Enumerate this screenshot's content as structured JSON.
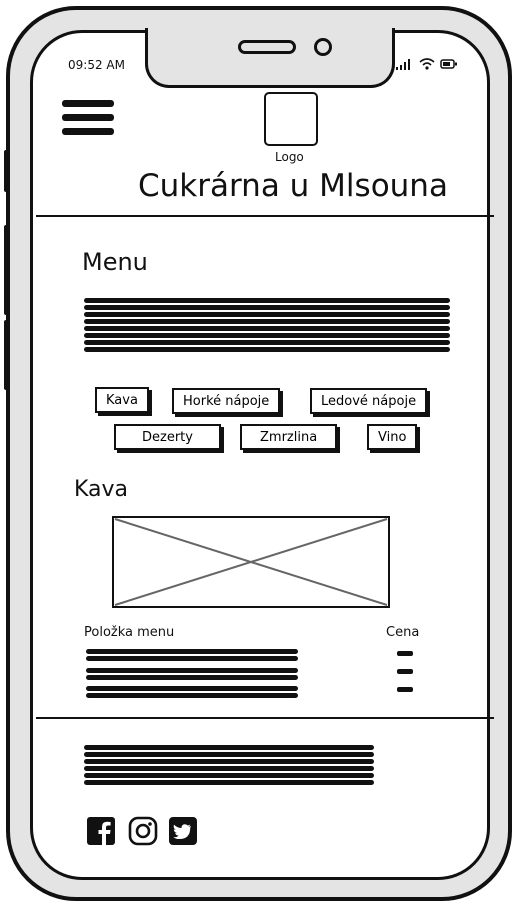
{
  "status_bar": {
    "time": "09:52 AM",
    "icons": ".ıl ⌔ ▭"
  },
  "header": {
    "logo_label": "Logo",
    "title": "Cukrárna u Mlsouna"
  },
  "menu_section": {
    "title": "Menu",
    "categories": [
      "Kava",
      "Horké nápoje",
      "Ledové nápoje",
      "Dezerty",
      "Zmrzlina",
      "Vino"
    ]
  },
  "kava_section": {
    "title": "Kava",
    "column_item": "Položka menu",
    "column_price": "Cena"
  },
  "icons": {
    "hamburger": "hamburger-menu-icon",
    "facebook": "facebook-icon",
    "instagram": "instagram-icon",
    "twitter": "twitter-icon"
  }
}
